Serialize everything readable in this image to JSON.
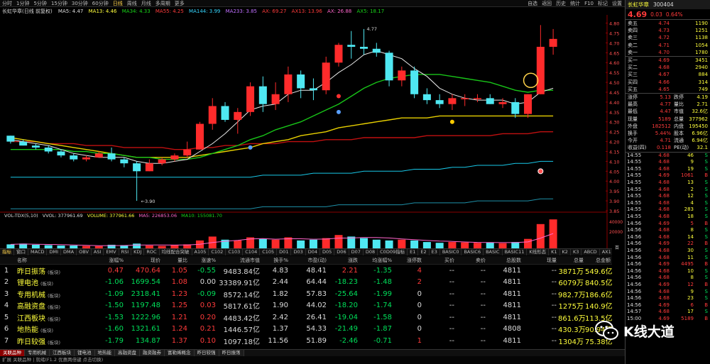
{
  "topbar": {
    "periods": [
      "分时",
      "1分钟",
      "5分钟",
      "15分钟",
      "30分钟",
      "60分钟",
      "日线",
      "周线",
      "月线",
      "多周期",
      "更多"
    ],
    "active_period": "日线",
    "right_buttons": [
      "自选",
      "返回",
      "历史",
      "统计",
      "F10",
      "标记",
      "设置"
    ]
  },
  "indicators_line": {
    "stock_name": "长虹华章(日线 前复权)",
    "ma5": "MA5: 4.47",
    "ma13": "MA13: 4.46",
    "ma34": "MA34: 4.33",
    "ma55": "MA55: 4.25",
    "ma144": "MA144: 3.99",
    "ma233": "MA233: 3.85",
    "a": "AX: 69.27",
    "b": "AX13: 13.96",
    "c": "AX: 26.88",
    "d": "AX5: 18.17"
  },
  "chart_annotations": {
    "high_label": "4.77",
    "low_label": "3.90"
  },
  "volume_line": {
    "label": "VOL-TDX(5,10)",
    "vvol": "VVOL: 377961.69",
    "volume": "VOLUME: 377961.66",
    "ma5": "MA5: 226853.06",
    "ma10": "MA10: 155081.70"
  },
  "volume_axis": {
    "top": "40000",
    "mid": "20000",
    "unit": "百"
  },
  "chart_axis_labels": [
    "4.80",
    "4.75",
    "4.70",
    "4.65",
    "4.60",
    "4.55",
    "4.50",
    "4.45",
    "4.40",
    "4.35",
    "4.30",
    "4.25",
    "4.20",
    "4.15",
    "4.10",
    "4.05",
    "4.00",
    "3.95",
    "3.90",
    "3.85"
  ],
  "chart_data": {
    "type": "candlestick",
    "note_colors": {
      "up": "#ff2b2b",
      "down": "#4fe8f2",
      "ma5": "#ffffff",
      "ma13": "#ffe600",
      "ma34": "#18d418",
      "ma55": "#d01818",
      "ma144": "#18c8e8"
    },
    "ohlc": [
      [
        4.23,
        4.23,
        4.19,
        4.2
      ],
      [
        4.2,
        4.21,
        4.18,
        4.18
      ],
      [
        4.18,
        4.19,
        4.16,
        4.17
      ],
      [
        4.17,
        4.18,
        4.14,
        4.15
      ],
      [
        4.15,
        4.16,
        4.12,
        4.13
      ],
      [
        4.13,
        4.14,
        4.1,
        4.11
      ],
      [
        4.11,
        4.13,
        4.1,
        4.12
      ],
      [
        4.12,
        4.15,
        4.12,
        4.14
      ],
      [
        4.14,
        4.17,
        4.1,
        4.11
      ],
      [
        4.11,
        4.12,
        4.07,
        4.09
      ],
      [
        4.09,
        4.1,
        3.9,
        4.05
      ],
      [
        4.05,
        4.11,
        4.05,
        4.09
      ],
      [
        4.09,
        4.12,
        4.08,
        4.11
      ],
      [
        4.11,
        4.14,
        4.1,
        4.13
      ],
      [
        4.13,
        4.2,
        4.12,
        4.16
      ],
      [
        4.16,
        4.3,
        4.16,
        4.29
      ],
      [
        4.29,
        4.42,
        4.26,
        4.38
      ],
      [
        4.38,
        4.4,
        4.3,
        4.31
      ],
      [
        4.31,
        4.37,
        4.24,
        4.35
      ],
      [
        4.35,
        4.5,
        4.33,
        4.48
      ],
      [
        4.48,
        4.53,
        4.35,
        4.39
      ],
      [
        4.39,
        4.5,
        4.36,
        4.44
      ],
      [
        4.44,
        4.58,
        4.4,
        4.54
      ],
      [
        4.54,
        4.56,
        4.42,
        4.47
      ],
      [
        4.47,
        4.52,
        4.41,
        4.46
      ],
      [
        4.46,
        4.63,
        4.44,
        4.6
      ],
      [
        4.6,
        4.7,
        4.58,
        4.69
      ],
      [
        4.69,
        4.76,
        4.62,
        4.68
      ],
      [
        4.68,
        4.77,
        4.64,
        4.67
      ],
      [
        4.67,
        4.7,
        4.63,
        4.65
      ],
      [
        4.65,
        4.66,
        4.48,
        4.51
      ],
      [
        4.51,
        4.58,
        4.48,
        4.56
      ],
      [
        4.56,
        4.58,
        4.42,
        4.44
      ],
      [
        4.44,
        4.47,
        4.39,
        4.41
      ],
      [
        4.41,
        4.44,
        4.37,
        4.39
      ],
      [
        4.39,
        4.44,
        4.36,
        4.42
      ],
      [
        4.42,
        4.44,
        4.38,
        4.42
      ],
      [
        4.42,
        4.44,
        4.4,
        4.42
      ],
      [
        4.42,
        4.44,
        4.39,
        4.39
      ],
      [
        4.39,
        4.42,
        4.37,
        4.4
      ],
      [
        4.4,
        4.42,
        4.32,
        4.34
      ],
      [
        4.34,
        4.44,
        4.32,
        4.44
      ],
      [
        4.44,
        4.79,
        4.44,
        4.68
      ],
      [
        4.68,
        4.77,
        4.64,
        4.72
      ]
    ],
    "ma5": [
      4.21,
      4.2,
      4.19,
      4.18,
      4.16,
      4.14,
      4.13,
      4.12,
      4.12,
      4.12,
      4.1,
      4.09,
      4.09,
      4.1,
      4.11,
      4.15,
      4.19,
      4.24,
      4.3,
      4.36,
      4.38,
      4.39,
      4.44,
      4.46,
      4.46,
      4.5,
      4.55,
      4.59,
      4.64,
      4.66,
      4.64,
      4.62,
      4.57,
      4.53,
      4.47,
      4.44,
      4.42,
      4.41,
      4.41,
      4.41,
      4.39,
      4.4,
      4.45,
      4.47
    ],
    "ma13": [
      4.16,
      4.16,
      4.16,
      4.16,
      4.16,
      4.15,
      4.15,
      4.14,
      4.14,
      4.13,
      4.12,
      4.12,
      4.11,
      4.11,
      4.11,
      4.12,
      4.14,
      4.16,
      4.18,
      4.21,
      4.23,
      4.26,
      4.28,
      4.3,
      4.33,
      4.36,
      4.39,
      4.43,
      4.47,
      4.5,
      4.52,
      4.53,
      4.54,
      4.54,
      4.54,
      4.53,
      4.52,
      4.51,
      4.5,
      4.48,
      4.46,
      4.45,
      4.46,
      4.46
    ],
    "ma34": [
      4.22,
      4.21,
      4.2,
      4.19,
      4.18,
      4.17,
      4.16,
      4.15,
      4.14,
      4.13,
      4.12,
      4.12,
      4.12,
      4.12,
      4.12,
      4.13,
      4.14,
      4.15,
      4.16,
      4.17,
      4.19,
      4.2,
      4.21,
      4.23,
      4.24,
      4.25,
      4.27,
      4.28,
      4.29,
      4.3,
      4.31,
      4.32,
      4.32,
      4.32,
      4.33,
      4.33,
      4.33,
      4.33,
      4.33,
      4.33,
      4.33,
      4.33,
      4.33,
      4.33
    ],
    "ma55": [
      4.2,
      4.2,
      4.2,
      4.19,
      4.19,
      4.19,
      4.18,
      4.18,
      4.18,
      4.17,
      4.17,
      4.17,
      4.17,
      4.16,
      4.16,
      4.17,
      4.17,
      4.18,
      4.18,
      4.19,
      4.19,
      4.19,
      4.2,
      4.2,
      4.2,
      4.21,
      4.21,
      4.21,
      4.22,
      4.22,
      4.22,
      4.22,
      4.22,
      4.23,
      4.23,
      4.23,
      4.23,
      4.23,
      4.23,
      4.24,
      4.24,
      4.24,
      4.25,
      4.25
    ],
    "ma144": [
      4.02,
      4.02,
      4.02,
      4.02,
      4.02,
      4.02,
      4.02,
      4.02,
      4.02,
      4.02,
      4.02,
      4.02,
      4.02,
      4.02,
      4.02,
      4.02,
      4.02,
      4.02,
      4.02,
      4.02,
      4.03,
      4.03,
      4.03,
      4.03,
      4.04,
      4.04,
      4.04,
      4.04,
      4.05,
      4.05,
      4.05,
      4.05,
      4.06,
      4.06,
      4.06,
      4.07,
      4.07,
      4.08,
      4.08,
      4.08,
      4.09,
      4.09,
      4.1,
      4.1
    ],
    "ma233": [
      3.86,
      3.86,
      3.86,
      3.86,
      3.86,
      3.86,
      3.86,
      3.86,
      3.86,
      3.86,
      3.86,
      3.86,
      3.86,
      3.86,
      3.86,
      3.86,
      3.86,
      3.86,
      3.86,
      3.86,
      3.87,
      3.87,
      3.87,
      3.87,
      3.87,
      3.87,
      3.88,
      3.88,
      3.88,
      3.88,
      3.88,
      3.88,
      3.89,
      3.89,
      3.89,
      3.89,
      3.89,
      3.9,
      3.9,
      3.9,
      3.9,
      3.9,
      3.91,
      3.91
    ],
    "volume": [
      60,
      70,
      55,
      50,
      45,
      45,
      40,
      38,
      55,
      50,
      70,
      45,
      40,
      50,
      60,
      110,
      160,
      120,
      110,
      150,
      130,
      120,
      150,
      110,
      120,
      140,
      180,
      160,
      140,
      120,
      110,
      120,
      110,
      90,
      80,
      90,
      85,
      80,
      85,
      75,
      90,
      130,
      320,
      380
    ]
  },
  "indicator_tabs": [
    "指标",
    "窗口",
    "MACD",
    "DMI",
    "DMA",
    "OBV",
    "ASI",
    "EMV",
    "RSI",
    "KDJ",
    "ROC",
    "均线配合突破",
    "A105",
    "C102",
    "C103",
    "C104",
    "C105",
    "D01",
    "D03",
    "D04",
    "D05",
    "D06",
    "D07",
    "D08",
    "C0D09指标",
    "E1",
    "E2",
    "E3",
    "BASIC0",
    "BASIC6",
    "BASIC",
    "BASIC11",
    "K线形态",
    "K1",
    "K2",
    "K3",
    "ABCD",
    "AX1",
    "AX2",
    "AX3",
    "AX4",
    "AX5",
    "设置"
  ],
  "indicator_tabs_active": "指标",
  "table_headers": [
    "",
    "名称",
    "涨幅%",
    "现价",
    "量比",
    "涨速%",
    "流通市值",
    "换手%",
    "市盈(动)",
    "涨跌",
    "均涨幅%",
    "涨停数",
    "买价",
    "卖价",
    "总股数",
    "现量",
    "总量",
    "总金额"
  ],
  "table_rows": [
    {
      "idx": "1",
      "name": "昨日振荡",
      "tag": "(板块)",
      "chg": "0.47",
      "price": "470.64",
      "vr": "1.05",
      "speed": "-0.55",
      "mcap": "9483.84亿",
      "turnover": "4.83",
      "pe": "48.41",
      "diff": "2.21",
      "avgchg": "-1.35",
      "limit": "4",
      "bid": "--",
      "ask": "--",
      "shares": "4811",
      "vol": "--",
      "total": "3871万",
      "amount": "549.6亿"
    },
    {
      "idx": "2",
      "name": "锂电池",
      "tag": "(板块)",
      "chg": "-1.06",
      "price": "1699.54",
      "vr": "1.08",
      "speed": "0.00",
      "mcap": "33389.91亿",
      "turnover": "2.44",
      "pe": "64.44",
      "diff": "-18.23",
      "avgchg": "-1.48",
      "limit": "2",
      "bid": "--",
      "ask": "--",
      "shares": "4811",
      "vol": "--",
      "total": "6079万",
      "amount": "840.5亿"
    },
    {
      "idx": "3",
      "name": "专用机械",
      "tag": "(板块)",
      "chg": "-1.09",
      "price": "2318.41",
      "vr": "1.23",
      "speed": "-0.09",
      "mcap": "8572.14亿",
      "turnover": "1.82",
      "pe": "57.83",
      "diff": "-25.64",
      "avgchg": "-1.99",
      "limit": "0",
      "bid": "--",
      "ask": "--",
      "shares": "4811",
      "vol": "--",
      "total": "982.7万",
      "amount": "186.6亿"
    },
    {
      "idx": "4",
      "name": "高融资盘",
      "tag": "(板块)",
      "chg": "-1.50",
      "price": "1197.48",
      "vr": "1.25",
      "speed": "0.03",
      "mcap": "5817.61亿",
      "turnover": "1.90",
      "pe": "44.02",
      "diff": "-18.20",
      "avgchg": "-1.74",
      "limit": "0",
      "bid": "--",
      "ask": "--",
      "shares": "4811",
      "vol": "--",
      "total": "1275万",
      "amount": "140.9亿"
    },
    {
      "idx": "5",
      "name": "江西板块",
      "tag": "(板块)",
      "chg": "-1.53",
      "price": "1222.96",
      "vr": "1.21",
      "speed": "0.20",
      "mcap": "4483.42亿",
      "turnover": "2.42",
      "pe": "26.41",
      "diff": "-19.04",
      "avgchg": "-1.58",
      "limit": "0",
      "bid": "--",
      "ask": "--",
      "shares": "4811",
      "vol": "--",
      "total": "861.6万",
      "amount": "113.5亿"
    },
    {
      "idx": "6",
      "name": "地热能",
      "tag": "(板块)",
      "chg": "-1.60",
      "price": "1321.61",
      "vr": "1.24",
      "speed": "0.21",
      "mcap": "1446.57亿",
      "turnover": "1.37",
      "pe": "54.33",
      "diff": "-21.49",
      "avgchg": "-1.87",
      "limit": "0",
      "bid": "--",
      "ask": "--",
      "shares": "4808",
      "vol": "--",
      "total": "430.3万",
      "amount": "90.94亿"
    },
    {
      "idx": "7",
      "name": "昨日较强",
      "tag": "(板块)",
      "chg": "-1.79",
      "price": "134.87",
      "vr": "1.37",
      "speed": "0.10",
      "mcap": "1097.18亿",
      "turnover": "11.56",
      "pe": "51.89",
      "diff": "-2.46",
      "avgchg": "-0.71",
      "limit": "1",
      "bid": "--",
      "ask": "--",
      "shares": "4811",
      "vol": "--",
      "total": "1304万",
      "amount": "75.38亿"
    }
  ],
  "bottom_tabs": [
    "关联品种",
    "专用机械",
    "江西板块",
    "锂电池",
    "地热能",
    "高融资盘",
    "融资融券",
    "富勒烯概念",
    "昨日较强",
    "昨日振荡"
  ],
  "bottom_tabs_active": "关联品种",
  "status_bar": "扩展  关联品种  |  就绪(F1.2 优惠两倍键  点击切换)",
  "right_panel": {
    "title": "长虹华章",
    "code": "300404",
    "price": "4.69",
    "change": "0.03",
    "change_pct": "0.64%",
    "asks": [
      {
        "label": "卖五",
        "price": "4.74",
        "vol": "1190"
      },
      {
        "label": "卖四",
        "price": "4.73",
        "vol": "1251"
      },
      {
        "label": "卖三",
        "price": "4.72",
        "vol": "1138"
      },
      {
        "label": "卖二",
        "price": "4.71",
        "vol": "1054"
      },
      {
        "label": "卖一",
        "price": "4.70",
        "vol": "1780"
      }
    ],
    "bids": [
      {
        "label": "买一",
        "price": "4.69",
        "vol": "3451"
      },
      {
        "label": "买二",
        "price": "4.68",
        "vol": "2940"
      },
      {
        "label": "买三",
        "price": "4.67",
        "vol": "884"
      },
      {
        "label": "买四",
        "price": "4.66",
        "vol": "314"
      },
      {
        "label": "买五",
        "price": "4.65",
        "vol": "749"
      }
    ],
    "stats": [
      {
        "l": "涨停",
        "lv": "5.13",
        "r": "跌停",
        "rv": "4.19"
      },
      {
        "l": "最高",
        "lv": "4.77",
        "r": "量比",
        "rv": "2.71"
      },
      {
        "l": "最低",
        "lv": "4.47",
        "r": "市值",
        "rv": "32.6亿"
      },
      {
        "l": "现量",
        "lv": "5189",
        "r": "总量",
        "rv": "377962"
      },
      {
        "l": "外盘",
        "lv": "182512",
        "r": "内盘",
        "rv": "195450"
      },
      {
        "l": "换手",
        "lv": "5.44%",
        "r": "股本",
        "rv": "6.96亿"
      },
      {
        "l": "今开",
        "lv": "4.71",
        "r": "流通",
        "rv": "6.94亿"
      },
      {
        "l": "收益(四)",
        "lv": "0.118",
        "r": "PE(动)",
        "rv": "32.1"
      }
    ],
    "trades": [
      {
        "t": "14:55",
        "p": "4.68",
        "v": "46",
        "d": "S"
      },
      {
        "t": "14:55",
        "p": "4.68",
        "v": "9",
        "d": "S"
      },
      {
        "t": "14:55",
        "p": "4.68",
        "v": "19",
        "d": "S"
      },
      {
        "t": "14:55",
        "p": "4.69",
        "v": "1061",
        "d": "B"
      },
      {
        "t": "14:55",
        "p": "4.68",
        "v": "13",
        "d": "S"
      },
      {
        "t": "14:55",
        "p": "4.68",
        "v": "2",
        "d": "S"
      },
      {
        "t": "14:55",
        "p": "4.68",
        "v": "12",
        "d": "S"
      },
      {
        "t": "14:55",
        "p": "4.68",
        "v": "4",
        "d": "S"
      },
      {
        "t": "14:55",
        "p": "4.68",
        "v": "283",
        "d": "S"
      },
      {
        "t": "14:55",
        "p": "4.68",
        "v": "18",
        "d": "S"
      },
      {
        "t": "14:56",
        "p": "4.69",
        "v": "5",
        "d": "B"
      },
      {
        "t": "14:56",
        "p": "4.68",
        "v": "8",
        "d": "S"
      },
      {
        "t": "14:56",
        "p": "4.68",
        "v": "14",
        "d": "S"
      },
      {
        "t": "14:56",
        "p": "4.69",
        "v": "22",
        "d": "B"
      },
      {
        "t": "14:56",
        "p": "4.68",
        "v": "30",
        "d": "S"
      },
      {
        "t": "14:56",
        "p": "4.68",
        "v": "11",
        "d": "S"
      },
      {
        "t": "14:56",
        "p": "4.69",
        "v": "4495",
        "d": "B"
      },
      {
        "t": "14:56",
        "p": "4.68",
        "v": "10",
        "d": "S"
      },
      {
        "t": "14:56",
        "p": "4.68",
        "v": "8",
        "d": "S"
      },
      {
        "t": "14:56",
        "p": "4.69",
        "v": "12",
        "d": "B"
      },
      {
        "t": "14:56",
        "p": "4.68",
        "v": "9",
        "d": "S"
      },
      {
        "t": "14:56",
        "p": "4.68",
        "v": "23",
        "d": "S"
      },
      {
        "t": "14:56",
        "p": "4.69",
        "v": "6",
        "d": "B"
      },
      {
        "t": "14:57",
        "p": "4.68",
        "v": "17",
        "d": "S"
      },
      {
        "t": "15:00",
        "p": "4.69",
        "v": "5189",
        "d": "B"
      }
    ]
  },
  "watermark": "K线大道"
}
